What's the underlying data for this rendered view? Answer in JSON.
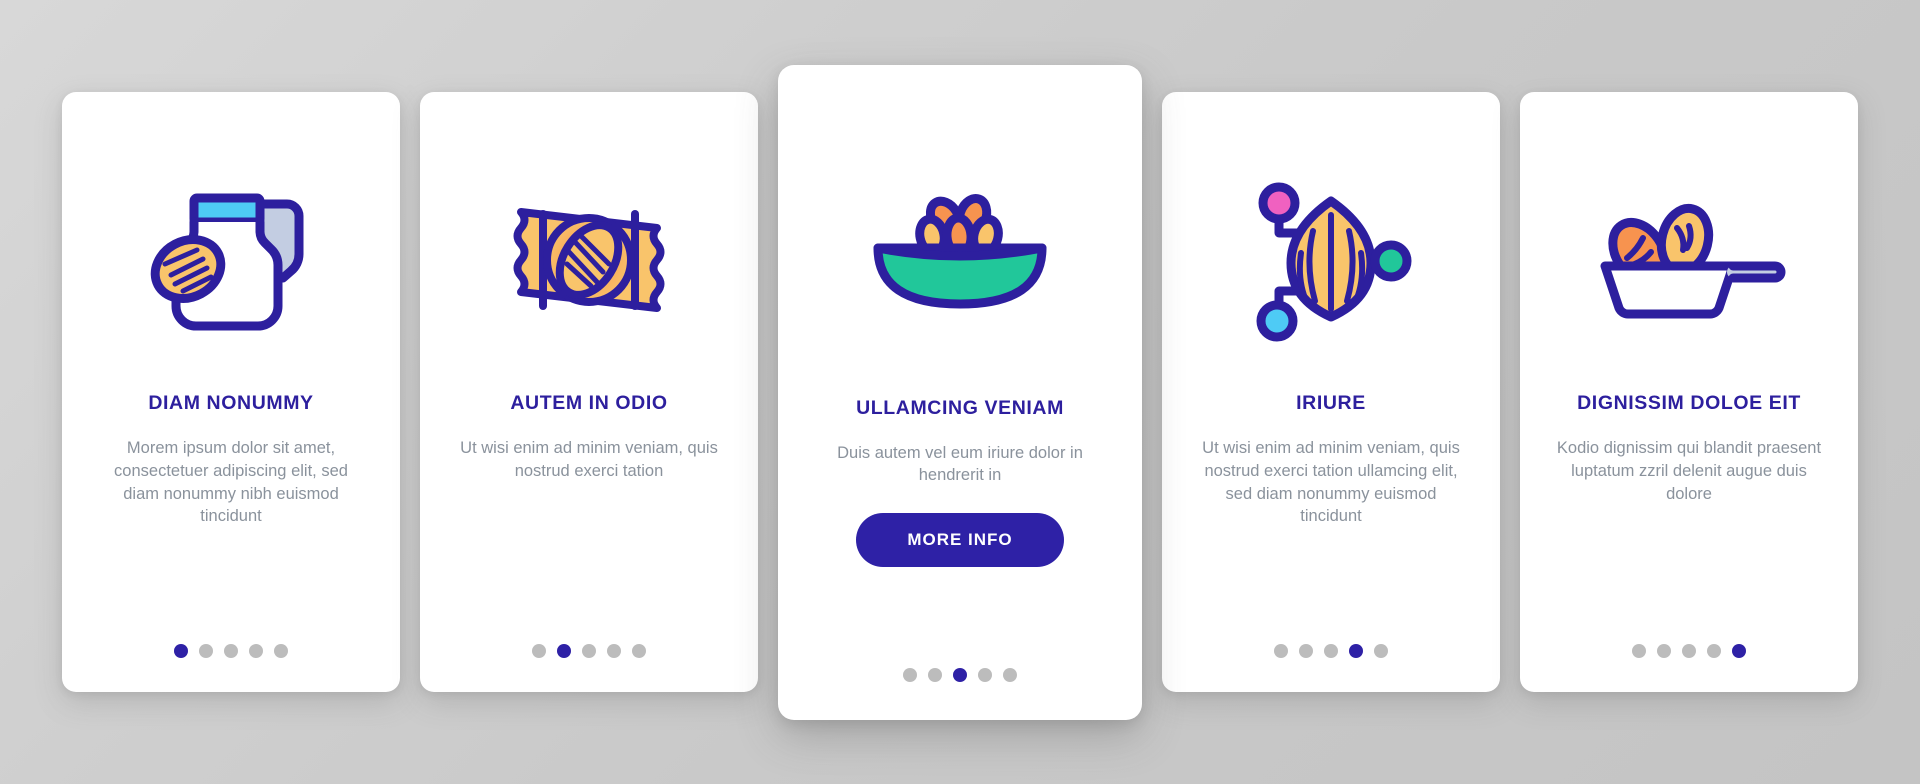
{
  "theme": {
    "accent": "#2e21a6",
    "title_color": "#2d1f9e",
    "body_color": "#8a929c",
    "dot_inactive": "#bcbcbc",
    "card_bg": "#ffffff",
    "page_bg": "#cfcfcf",
    "icon_stroke": "#2d1f9e",
    "icon_yellow": "#f9c46b",
    "icon_orange": "#f7934f",
    "icon_cyan": "#4ecbf5",
    "icon_teal": "#21c79a",
    "icon_pink": "#f061c0",
    "icon_lavender": "#c3cde2"
  },
  "cards": [
    {
      "id": "card-1",
      "icon": "pitcher-almond-icon",
      "title": "DIAM NONUMMY",
      "body": "Morem ipsum dolor sit amet, consectetuer adipiscing elit, sed diam nonummy nibh euismod tincidunt",
      "featured": false,
      "cta": null,
      "dots": {
        "count": 5,
        "active_index": 0
      }
    },
    {
      "id": "card-2",
      "icon": "snack-package-almond-icon",
      "title": "AUTEM IN ODIO",
      "body": "Ut wisi enim ad minim veniam, quis nostrud exerci tation",
      "featured": false,
      "cta": null,
      "dots": {
        "count": 5,
        "active_index": 1
      }
    },
    {
      "id": "card-3",
      "icon": "bowl-almonds-icon",
      "title": "ULLAMCING VENIAM",
      "body": "Duis autem vel eum iriure dolor in hendrerit in",
      "featured": true,
      "cta": "MORE INFO",
      "dots": {
        "count": 5,
        "active_index": 2
      }
    },
    {
      "id": "card-4",
      "icon": "almond-nodes-network-icon",
      "title": "IRIURE",
      "body": "Ut wisi enim ad minim veniam, quis nostrud exerci tation ullamcing elit, sed diam nonummy euismod tincidunt",
      "featured": false,
      "cta": null,
      "dots": {
        "count": 5,
        "active_index": 3
      }
    },
    {
      "id": "card-5",
      "icon": "frying-pan-almonds-icon",
      "title": "DIGNISSIM DOLOE EIT",
      "body": "Kodio dignissim qui blandit praesent luptatum zzril delenit augue duis dolore",
      "featured": false,
      "cta": null,
      "dots": {
        "count": 5,
        "active_index": 4
      }
    }
  ]
}
